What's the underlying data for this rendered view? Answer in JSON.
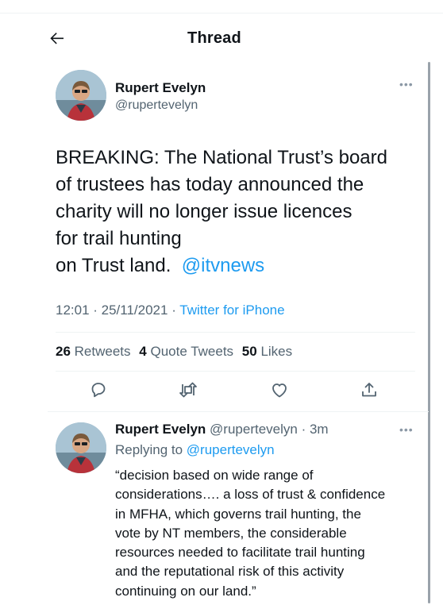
{
  "header": {
    "title": "Thread",
    "back_icon": "arrow-left-icon"
  },
  "tweet": {
    "author_name": "Rupert Evelyn",
    "author_handle": "@rupertevelyn",
    "text_lines": [
      "BREAKING: The National Trust’s board",
      "of trustees has today announced the",
      "charity will no longer issue licences",
      "for trail hunting",
      "on Trust land."
    ],
    "mention": "@itvnews",
    "time": "12:01 · 25/11/2021 · ",
    "source": "Twitter for iPhone",
    "stats": {
      "retweets_count": "26",
      "retweets_label": "Retweets",
      "quotes_count": "4",
      "quotes_label": "Quote Tweets",
      "likes_count": "50",
      "likes_label": "Likes"
    },
    "actions": [
      "reply-icon",
      "retweet-icon",
      "like-icon",
      "share-icon"
    ]
  },
  "reply": {
    "author_name": "Rupert Evelyn",
    "author_handle": "@rupertevelyn",
    "age": "· 3m",
    "replying_prefix": "Replying to",
    "replying_to": "@rupertevelyn",
    "text_lines": [
      "“decision based on wide range of",
      "considerations…. a loss of trust & confidence",
      "in MFHA, which governs trail hunting, the",
      "vote by NT members, the considerable",
      "resources needed to facilitate trail hunting",
      "and the reputational risk of this activity",
      "continuing on our land.”"
    ]
  },
  "colors": {
    "accent": "#1d9bf0",
    "secondary_text": "#536471",
    "divider": "#eff3f4"
  }
}
